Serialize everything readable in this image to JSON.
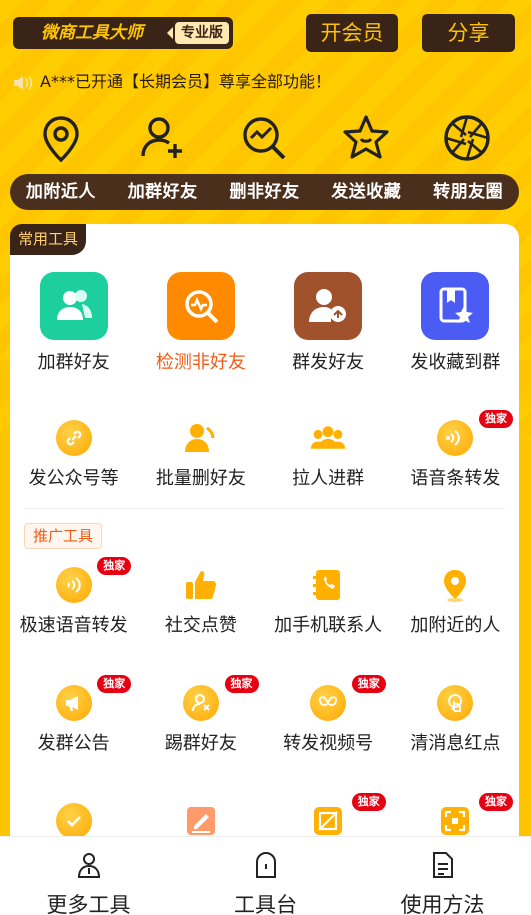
{
  "header": {
    "brand": "微商工具大师",
    "brand_badge": "专业版",
    "vip_button": "开会员",
    "share_button": "分享"
  },
  "notice": {
    "icon": "speaker-icon",
    "text": "A***已开通【长期会员】尊享全部功能！"
  },
  "features": [
    {
      "label": "加附近人",
      "icon": "location-pin-icon"
    },
    {
      "label": "加群好友",
      "icon": "add-user-icon"
    },
    {
      "label": "删非好友",
      "icon": "search-chart-icon"
    },
    {
      "label": "发送收藏",
      "icon": "star-icon"
    },
    {
      "label": "转朋友圈",
      "icon": "aperture-icon"
    }
  ],
  "common_tools": {
    "tag": "常用工具",
    "primary": [
      {
        "label": "加群好友",
        "icon": "group-users-icon",
        "color": "#1ccf9c"
      },
      {
        "label": "检测非好友",
        "icon": "detect-search-icon",
        "color": "#ff8a00",
        "active": true
      },
      {
        "label": "群发好友",
        "icon": "user-share-icon",
        "color": "#a0522d"
      },
      {
        "label": "发收藏到群",
        "icon": "bookmark-star-icon",
        "color": "#4b5cf5"
      }
    ],
    "secondary": [
      {
        "label": "发公众号等",
        "icon": "link-icon"
      },
      {
        "label": "批量删好友",
        "icon": "user-remove-icon"
      },
      {
        "label": "拉人进群",
        "icon": "team-icon"
      },
      {
        "label": "语音条转发",
        "icon": "voice-forward-icon",
        "badge": "独家"
      }
    ]
  },
  "promo_tools": {
    "tag": "推广工具",
    "rows": [
      [
        {
          "label": "极速语音转发",
          "icon": "voice-wave-icon",
          "badge": "独家"
        },
        {
          "label": "社交点赞",
          "icon": "thumbs-up-icon"
        },
        {
          "label": "加手机联系人",
          "icon": "contact-book-icon"
        },
        {
          "label": "加附近的人",
          "icon": "map-pin-icon"
        }
      ],
      [
        {
          "label": "发群公告",
          "icon": "megaphone-icon",
          "badge": "独家"
        },
        {
          "label": "踢群好友",
          "icon": "kick-user-icon",
          "badge": "独家"
        },
        {
          "label": "转发视频号",
          "icon": "butterfly-icon",
          "badge": "独家"
        },
        {
          "label": "清消息红点",
          "icon": "tap-icon"
        }
      ],
      [
        {
          "label": "",
          "icon": "check-circle-icon"
        },
        {
          "label": "",
          "icon": "edit-note-icon"
        },
        {
          "label": "",
          "icon": "no-image-icon",
          "badge": "独家"
        },
        {
          "label": "",
          "icon": "scan-frame-icon",
          "badge": "独家"
        }
      ]
    ]
  },
  "tabbar": [
    {
      "label": "更多工具",
      "icon": "person-tools-icon"
    },
    {
      "label": "工具台",
      "icon": "desk-icon",
      "active": true
    },
    {
      "label": "使用方法",
      "icon": "document-icon"
    }
  ],
  "colors": {
    "accent": "#ffc400",
    "dark": "#3a2418",
    "highlight": "#f25c18",
    "exclusive_badge": "#e60012"
  }
}
